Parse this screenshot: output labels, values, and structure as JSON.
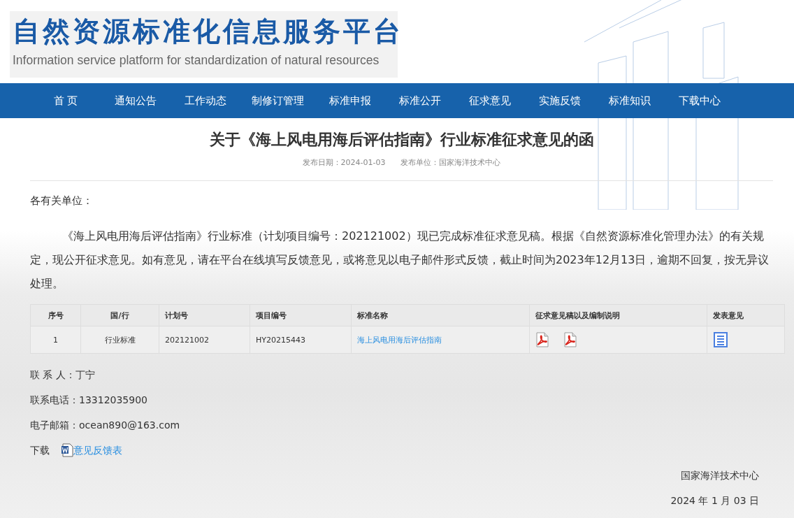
{
  "header": {
    "title": "自然资源标准化信息服务平台",
    "subtitle": "Information service platform for standardization of natural resources"
  },
  "nav": [
    "首 页",
    "通知公告",
    "工作动态",
    "制修订管理",
    "标准申报",
    "标准公开",
    "征求意见",
    "实施反馈",
    "标准知识",
    "下载中心"
  ],
  "article": {
    "title": "关于《海上风电用海后评估指南》行业标准征求意见的函",
    "date": "发布日期：2024-01-03",
    "publisher": "发布单位：国家海洋技术中心",
    "salutation": "各有关单位：",
    "body": "《海上风电用海后评估指南》行业标准（计划项目编号：202121002）现已完成标准征求意见稿。根据《自然资源标准化管理办法》的有关规定，现公开征求意见。如有意见，请在平台在线填写反馈意见，或将意见以电子邮件形式反馈，截止时间为2023年12月13日，逾期不回复，按无异议处理。"
  },
  "table": {
    "columns": [
      "序号",
      "国/行",
      "计划号",
      "项目编号",
      "标准名称",
      "征求意见稿以及编制说明",
      "发表意见"
    ],
    "rows": [
      {
        "number": "1",
        "level": "行业标准",
        "plan": "202121002",
        "project": "HY20215443",
        "name": "海上风电用海后评估指南",
        "files": [
          {
            "kind": "pdf"
          },
          {
            "kind": "pdf"
          }
        ]
      }
    ]
  },
  "contacts": [
    "联 系 人：丁宁",
    "联系电话：13312035900",
    "电子邮箱：ocean890@163.com"
  ],
  "download": {
    "label": "下载",
    "link": "意见反馈表"
  },
  "signature": {
    "org": "国家海洋技术中心",
    "date": "2024 年 1 月 03 日"
  }
}
